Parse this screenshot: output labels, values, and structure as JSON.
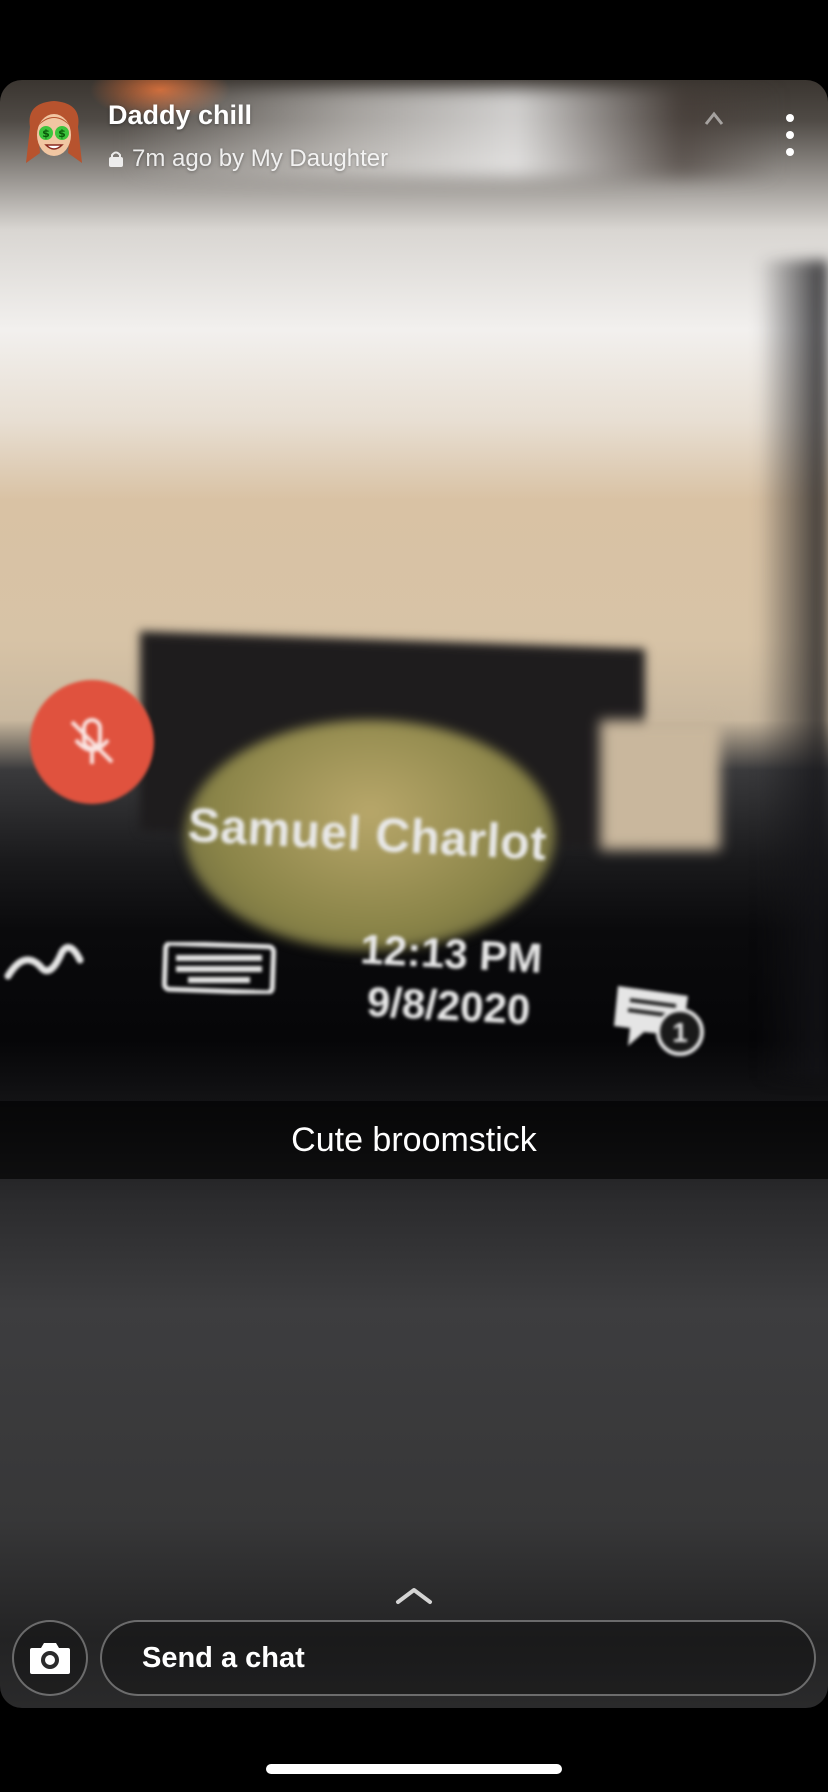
{
  "header": {
    "name": "Daddy chill",
    "meta": "7m ago by My Daughter"
  },
  "photo": {
    "caller_name": "Samuel Charlot",
    "time": "12:13 PM",
    "date": "9/8/2020",
    "notification_count": "1"
  },
  "caption": "Cute broomstick",
  "footer": {
    "chat_placeholder": "Send a chat"
  },
  "colors": {
    "mic_off": "#e0523e",
    "caption_bg": "rgba(0,0,0,0.62)"
  }
}
